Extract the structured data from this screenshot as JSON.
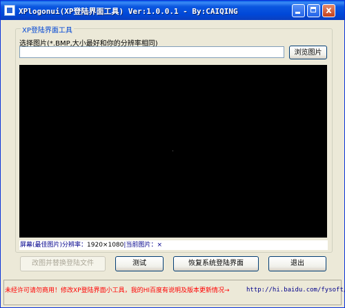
{
  "window": {
    "title": "XPlogonui(XP登陆界面工具) Ver:1.0.0.1 - By:CAIQING",
    "minimize_label": "",
    "close_label": "x"
  },
  "group": {
    "title": "XP登陆界面工具",
    "select_label": "选择图片(*.BMP,大小最好和你的分辨率相同)",
    "path_value": "",
    "browse_label": "浏览图片"
  },
  "status": {
    "resolution_label": "屏幕(最佳图片)分辨率：",
    "resolution_value": "1920×1080",
    "separator": "|",
    "current_label": "当前图片：",
    "current_value": "×"
  },
  "buttons": {
    "replace": "改图并替换登陆文件",
    "test": "测试",
    "restore": "恢复系统登陆界面",
    "exit": "退出"
  },
  "footer": {
    "note": "未经许可请勿商用！修改XP登陆界面小工具，我的HI百度有说明及版本更新情况→",
    "link": "http://hi.baidu.com/fysoft/"
  },
  "colors": {
    "title_bar": "#0a50d8",
    "footer_note": "#ff0000",
    "group_title": "#0046d5",
    "preview_background": "#000000"
  }
}
